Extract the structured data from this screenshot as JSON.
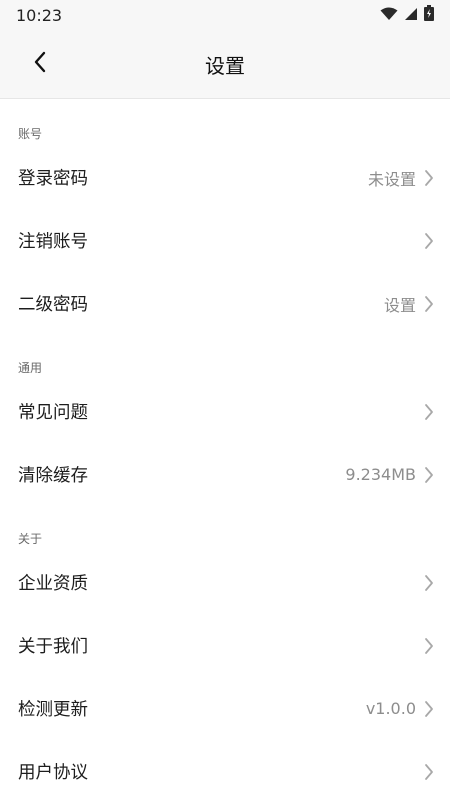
{
  "status_bar": {
    "time": "10:23",
    "icons": [
      "wifi-icon",
      "cellular-signal-icon",
      "battery-charging-icon"
    ]
  },
  "nav": {
    "title": "设置",
    "back_icon": "chevron-left-icon"
  },
  "sections": [
    {
      "title": "账号",
      "items": [
        {
          "label": "登录密码",
          "value": "未设置"
        },
        {
          "label": "注销账号",
          "value": ""
        },
        {
          "label": "二级密码",
          "value": "设置"
        }
      ]
    },
    {
      "title": "通用",
      "items": [
        {
          "label": "常见问题",
          "value": ""
        },
        {
          "label": "清除缓存",
          "value": "9.234MB"
        }
      ]
    },
    {
      "title": "关于",
      "items": [
        {
          "label": "企业资质",
          "value": ""
        },
        {
          "label": "关于我们",
          "value": ""
        },
        {
          "label": "检测更新",
          "value": "v1.0.0"
        },
        {
          "label": "用户协议",
          "value": ""
        }
      ]
    }
  ],
  "colors": {
    "background": "#ffffff",
    "header_background": "#f7f7f7",
    "label_text": "#1d1d1d",
    "value_text": "#8d8d8d",
    "section_text": "#6a6a6a",
    "chevron": "#a8a8a8"
  }
}
